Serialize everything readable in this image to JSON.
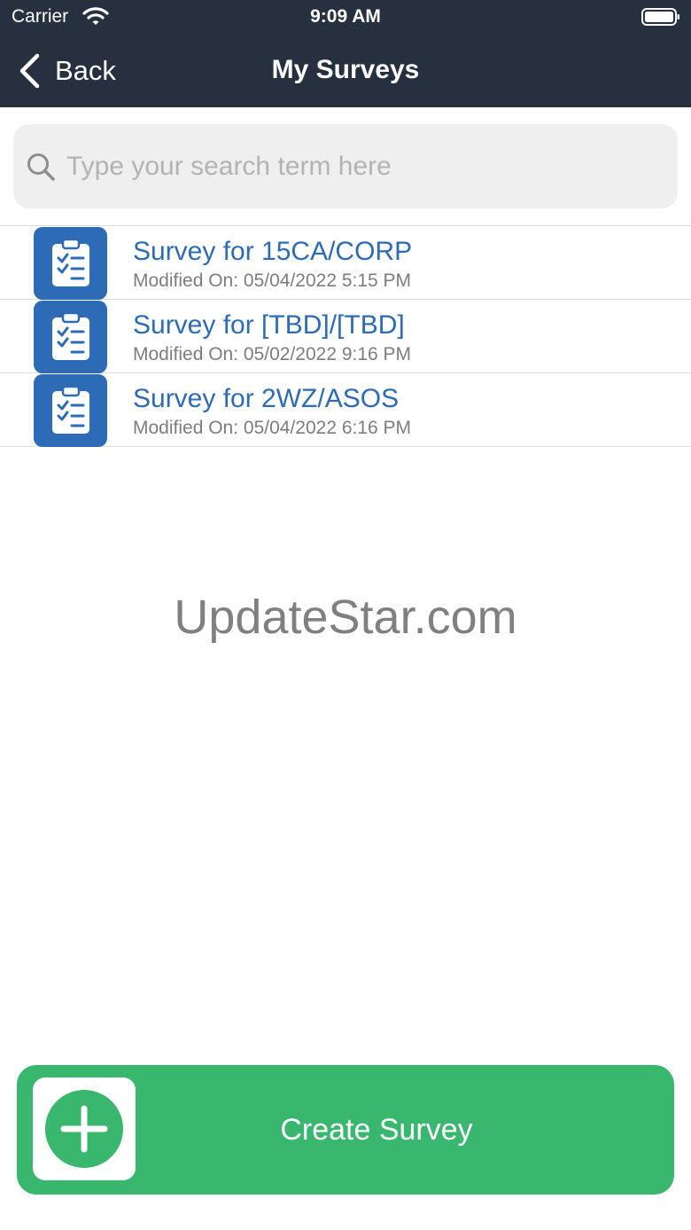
{
  "status_bar": {
    "carrier": "Carrier",
    "time": "9:09 AM"
  },
  "nav": {
    "back_label": "Back",
    "title": "My Surveys"
  },
  "search": {
    "placeholder": "Type your search term here"
  },
  "surveys": [
    {
      "title": "Survey for 15CA/CORP",
      "modified": "Modified On: 05/04/2022 5:15 PM"
    },
    {
      "title": "Survey for [TBD]/[TBD]",
      "modified": "Modified On: 05/02/2022 9:16 PM"
    },
    {
      "title": "Survey for 2WZ/ASOS",
      "modified": "Modified On: 05/04/2022 6:16 PM"
    }
  ],
  "watermark": "UpdateStar.com",
  "create_button": {
    "label": "Create Survey"
  },
  "colors": {
    "header_bg": "#27303f",
    "accent_blue": "#2d6bb6",
    "create_green": "#3ab76f"
  },
  "icons": {
    "list_item": "clipboard-checklist-icon",
    "create": "plus-circle-icon",
    "search": "search-icon"
  }
}
